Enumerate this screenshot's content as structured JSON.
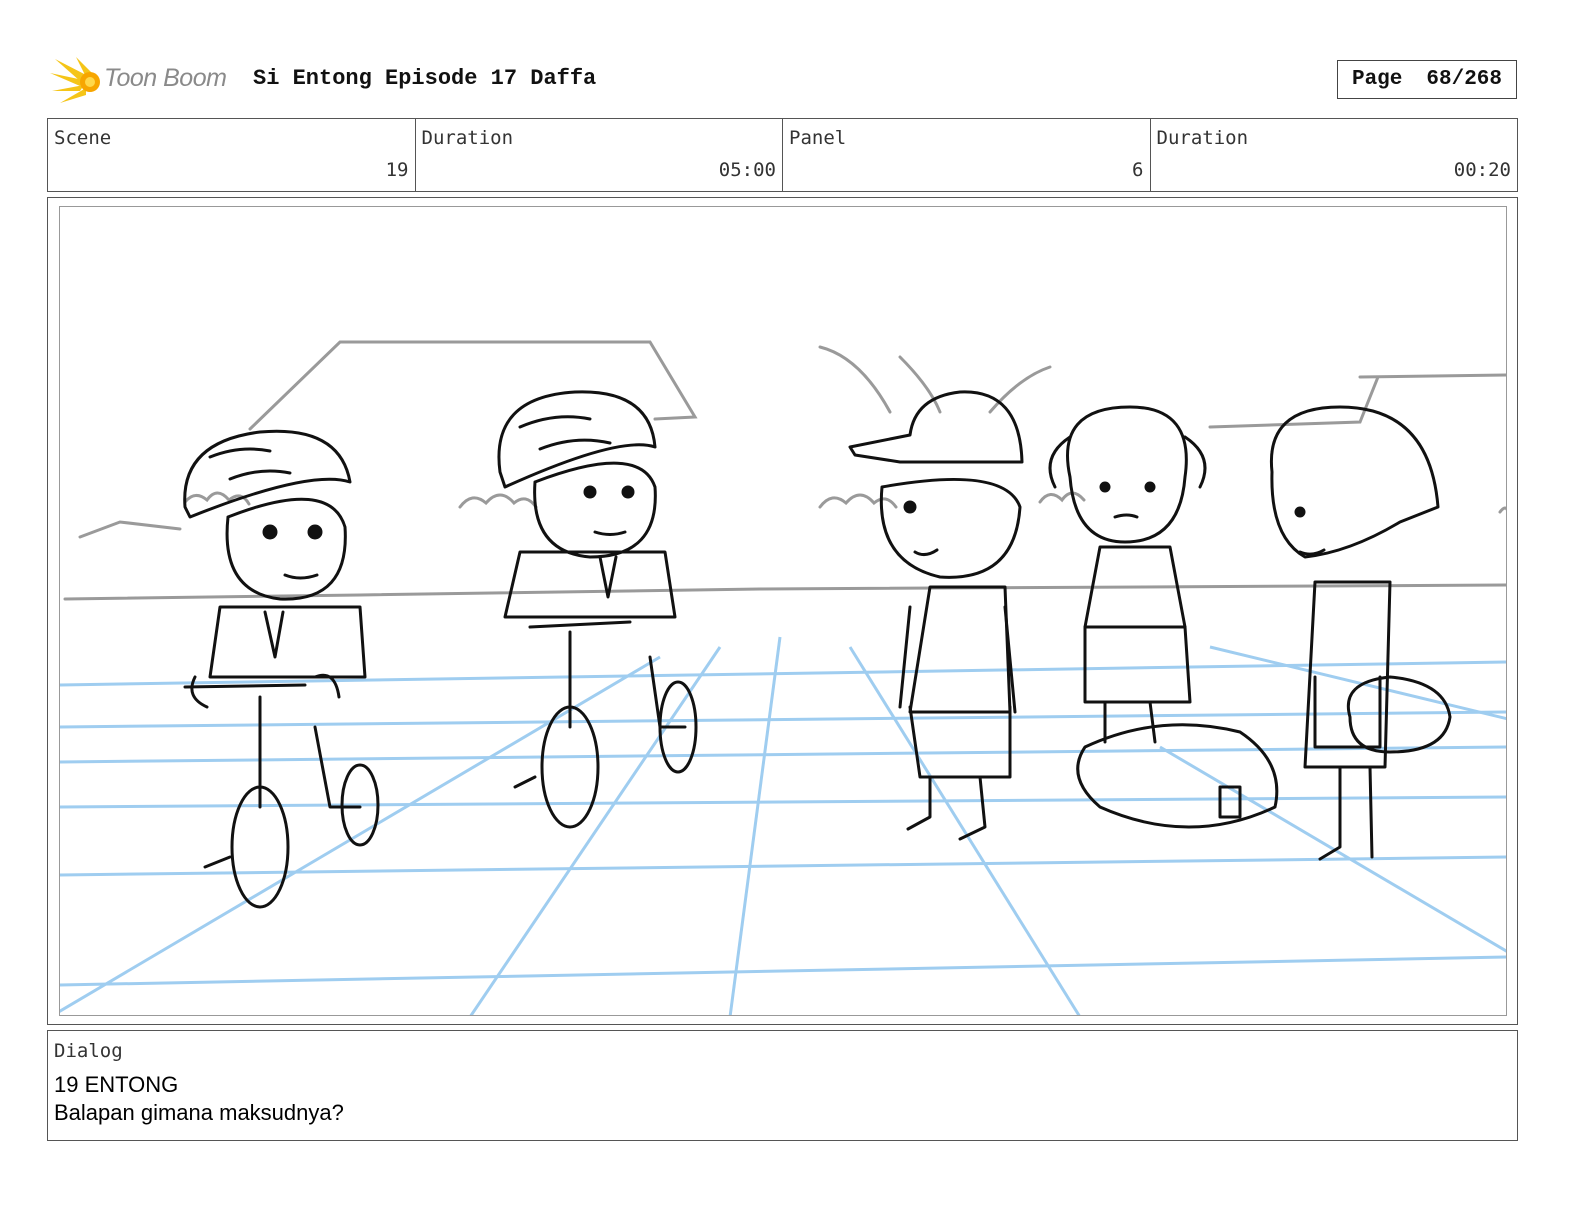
{
  "header": {
    "logo_text": "Toon Boom",
    "title": "Si Entong Episode 17 Daffa",
    "page_label": "Page",
    "page_value": "68/268"
  },
  "info": {
    "scene_label": "Scene",
    "scene_value": "19",
    "scene_duration_label": "Duration",
    "scene_duration_value": "05:00",
    "panel_label": "Panel",
    "panel_value": "6",
    "panel_duration_label": "Duration",
    "panel_duration_value": "00:20"
  },
  "dialog": {
    "label": "Dialog",
    "lines": [
      "19 ENTONG",
      "Balapan gimana maksudnya?"
    ]
  },
  "colors": {
    "logo_burst": "#f5c518",
    "sketch_ink": "#111111",
    "sketch_grey": "#9a9a9a",
    "perspective_grid": "#9fcdf0"
  }
}
